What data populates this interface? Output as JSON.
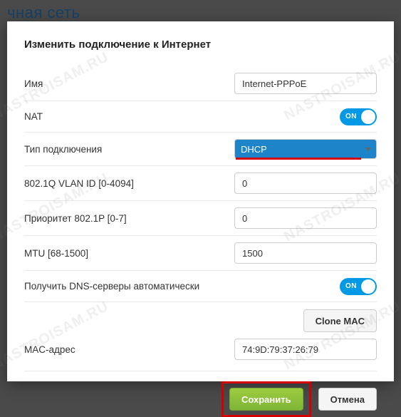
{
  "backdrop": {
    "partial_text": "чная сеть"
  },
  "modal": {
    "title": "Изменить подключение к Интернет",
    "fields": {
      "name": {
        "label": "Имя",
        "value": "Internet-PPPoE"
      },
      "nat": {
        "label": "NAT",
        "toggle_state": "ON"
      },
      "conn_type": {
        "label": "Тип подключения",
        "value": "DHCP"
      },
      "vlan_id": {
        "label": "802.1Q VLAN ID [0-4094]",
        "value": "0"
      },
      "priority": {
        "label": "Приоритет 802.1P [0-7]",
        "value": "0"
      },
      "mtu": {
        "label": "MTU [68-1500]",
        "value": "1500"
      },
      "dns_auto": {
        "label": "Получить DNS-серверы автоматически",
        "toggle_state": "ON"
      },
      "clone_mac": {
        "label": "Clone MAC"
      },
      "mac": {
        "label": "MAC-адрес",
        "value": "74:9D:79:37:26:79"
      }
    },
    "buttons": {
      "save": "Сохранить",
      "cancel": "Отмена"
    }
  },
  "watermark": "NASTROISAM.RU"
}
